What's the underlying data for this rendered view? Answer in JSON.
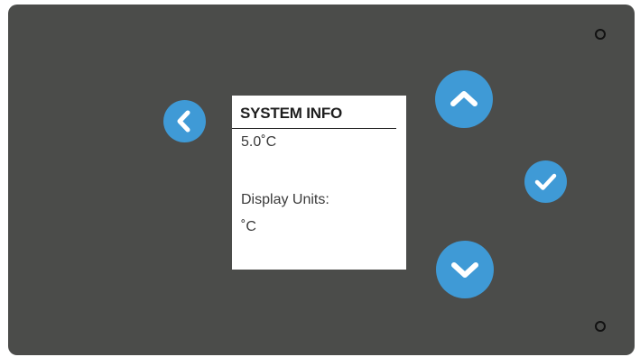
{
  "screen": {
    "title": "SYSTEM INFO",
    "temperature": "5.0˚C",
    "display_units_label": "Display Units:",
    "display_units_value": "˚C"
  },
  "buttons": {
    "back": {
      "icon": "chevron-left-icon"
    },
    "up": {
      "icon": "chevron-up-icon"
    },
    "confirm": {
      "icon": "checkmark-icon"
    },
    "down": {
      "icon": "chevron-down-icon"
    }
  },
  "colors": {
    "panel": "#4b4c4a",
    "button": "#3f9ad6",
    "screen": "#ffffff"
  }
}
